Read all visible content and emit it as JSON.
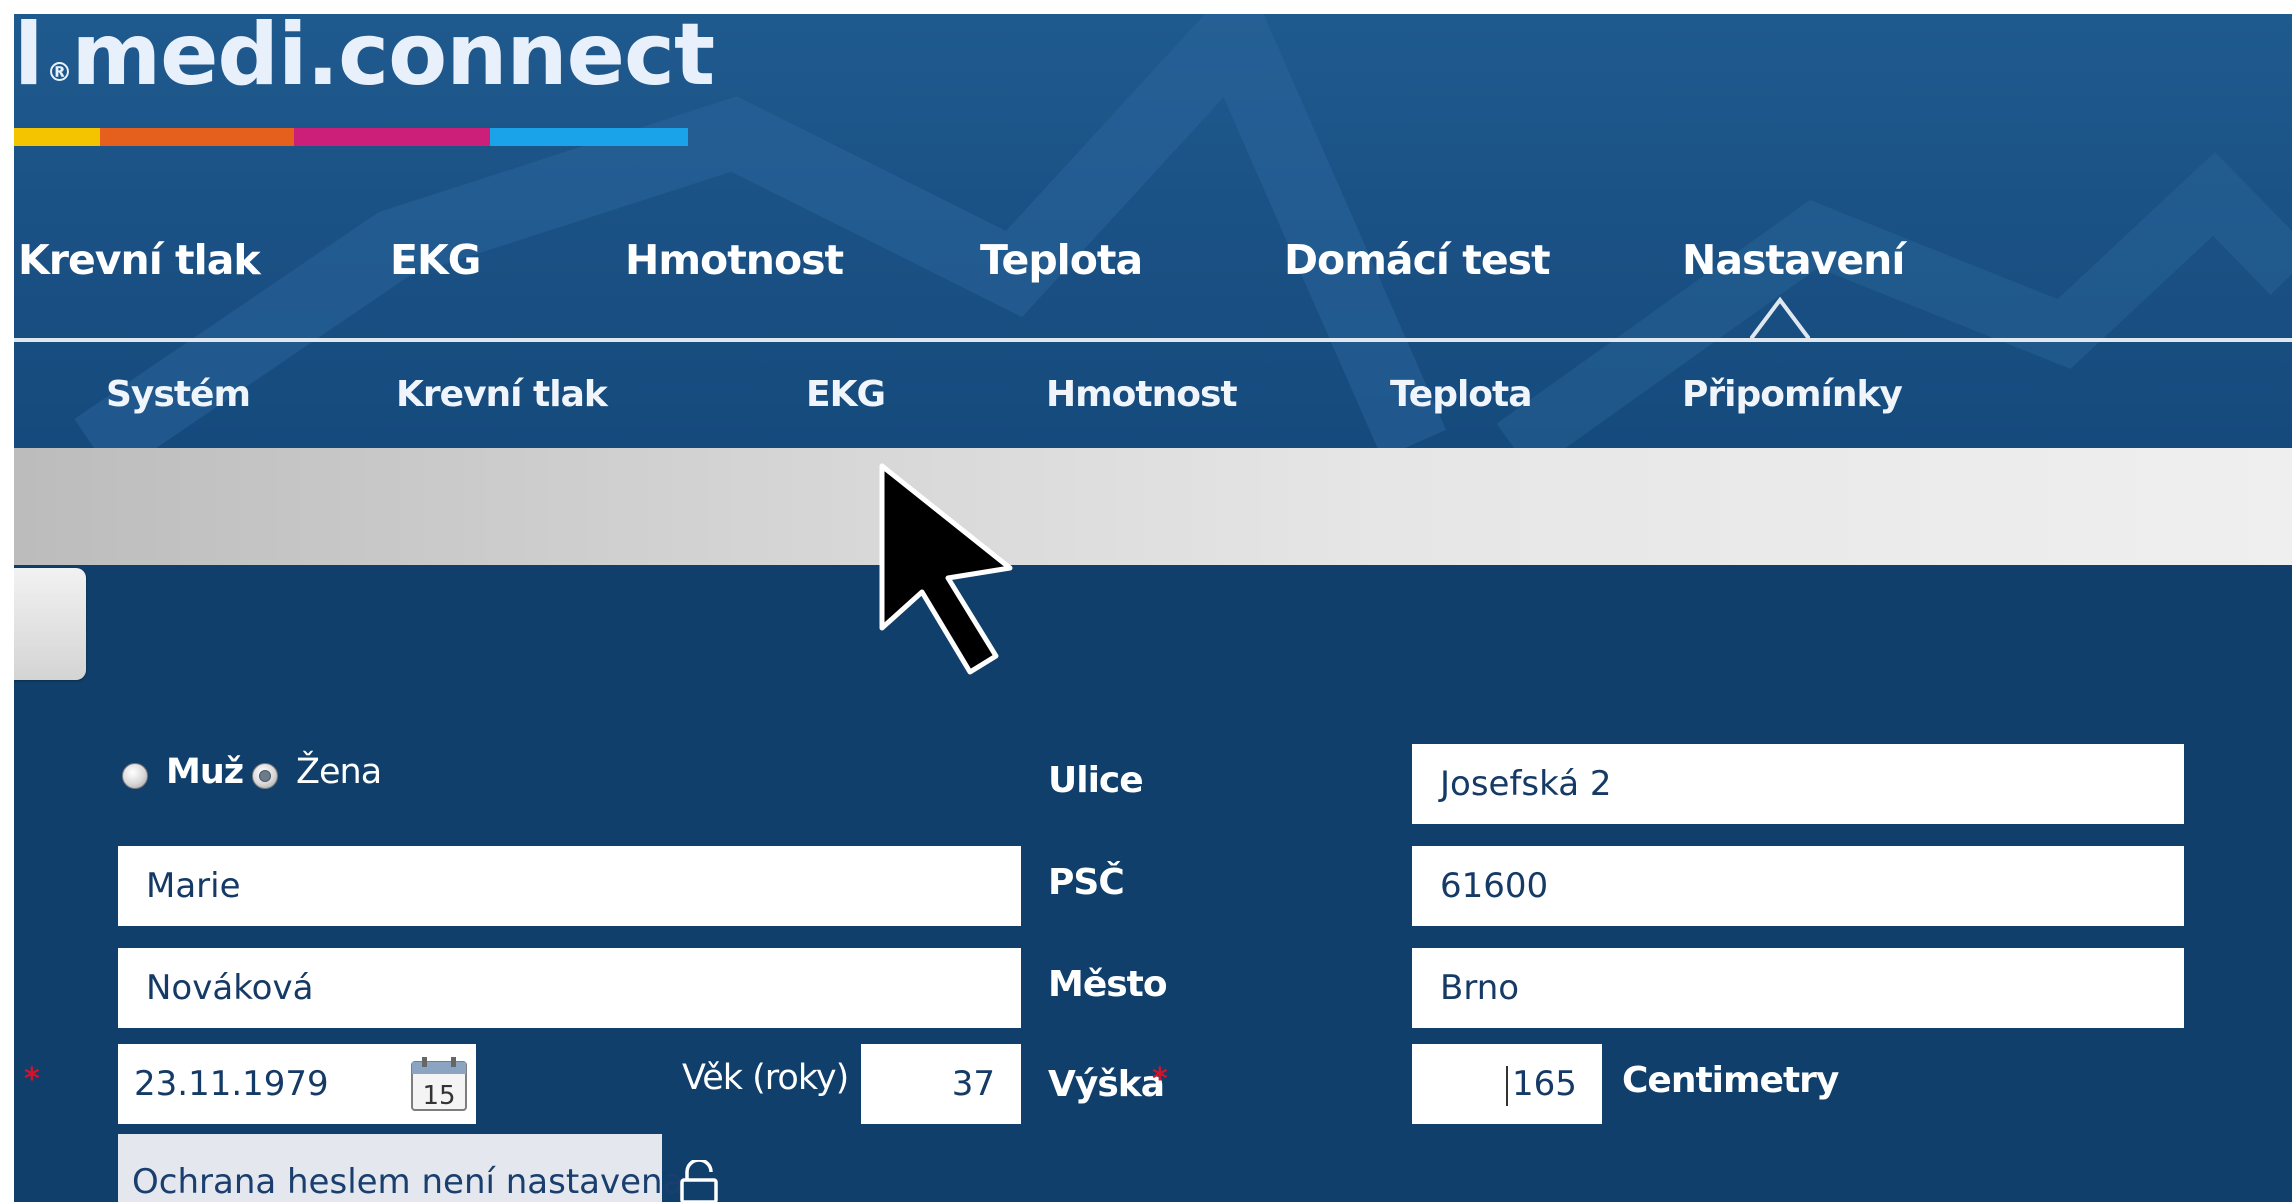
{
  "logo": {
    "text": "medi.connect",
    "prefix": "l",
    "reg_mark": "®"
  },
  "brand_colors": [
    "#f5c400",
    "#e5601c",
    "#cc1f7a",
    "#1aa3e8"
  ],
  "main_nav": {
    "items": [
      {
        "label": "Krevní tlak"
      },
      {
        "label": "EKG"
      },
      {
        "label": "Hmotnost"
      },
      {
        "label": "Teplota"
      },
      {
        "label": "Domácí test"
      },
      {
        "label": "Nastavení",
        "active": true
      }
    ]
  },
  "sub_nav": {
    "items": [
      {
        "label": "Systém"
      },
      {
        "label": "Krevní tlak"
      },
      {
        "label": "EKG"
      },
      {
        "label": "Hmotnost"
      },
      {
        "label": "Teplota"
      },
      {
        "label": "Připomínky"
      }
    ]
  },
  "form": {
    "gender": {
      "male_label": "Muž",
      "female_label": "Žena",
      "selected": "Žena"
    },
    "first_name": "Marie",
    "last_name": "Nováková",
    "birth_date": "23.11.1979",
    "calendar_day": "15",
    "age_label": "Věk (roky)",
    "age_value": "37",
    "password_status": "Ochrana heslem není nastavena",
    "street_label": "Ulice",
    "street_value": "Josefská 2",
    "zip_label": "PSČ",
    "zip_value": "61600",
    "city_label": "Město",
    "city_value": "Brno",
    "height_label": "Výška",
    "height_value": "165",
    "height_unit": "Centimetry",
    "required_mark": "*"
  }
}
